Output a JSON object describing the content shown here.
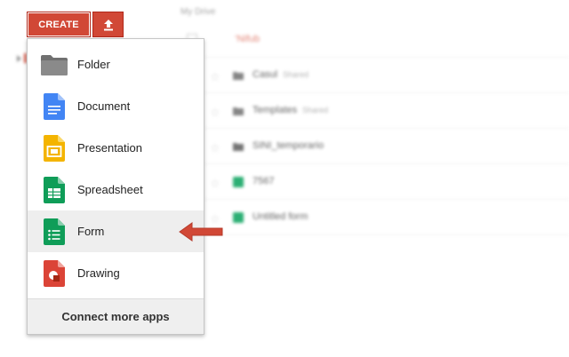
{
  "toolbar": {
    "create_label": "CREATE",
    "create_color": "#d14836"
  },
  "background": {
    "section_title": "My Drive",
    "rows": [
      {
        "name": "‘Nifub",
        "shared": "",
        "icon": "none",
        "color": "#e07b6c"
      },
      {
        "name": "Casul",
        "shared": "Shared",
        "icon": "shared-folder",
        "color": "#777"
      },
      {
        "name": "Templates",
        "shared": "Shared",
        "icon": "shared-folder",
        "color": "#777"
      },
      {
        "name": "SINI_temporario",
        "shared": "",
        "icon": "folder",
        "color": "#777"
      },
      {
        "name": "7567",
        "shared": "",
        "icon": "form",
        "color": "#16a765"
      },
      {
        "name": "Untitled form",
        "shared": "",
        "icon": "form",
        "color": "#16a765"
      }
    ]
  },
  "menu": {
    "items": [
      {
        "label": "Folder",
        "icon": "folder-icon",
        "color": "#707070"
      },
      {
        "label": "Document",
        "icon": "document-icon",
        "color": "#4285f4"
      },
      {
        "label": "Presentation",
        "icon": "presentation-icon",
        "color": "#f4b400"
      },
      {
        "label": "Spreadsheet",
        "icon": "spreadsheet-icon",
        "color": "#0f9d58"
      },
      {
        "label": "Form",
        "icon": "form-icon",
        "color": "#0f9d58",
        "highlighted": true
      },
      {
        "label": "Drawing",
        "icon": "drawing-icon",
        "color": "#db4437"
      }
    ],
    "connect_label": "Connect more apps"
  },
  "annotation": {
    "arrow_color": "#d14836",
    "points_to": "Form"
  }
}
